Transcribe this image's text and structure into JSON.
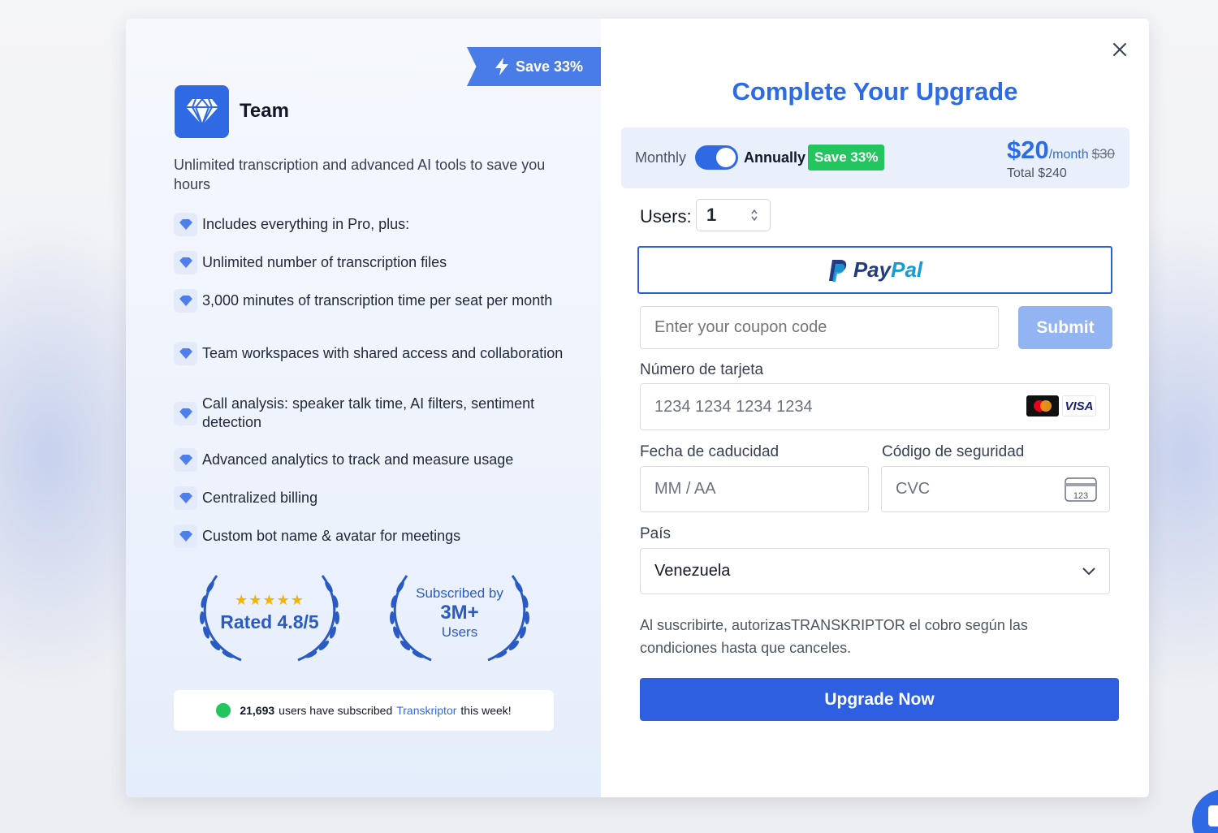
{
  "colors": {
    "accent": "#2d6be4",
    "success": "#22c55e",
    "submit_disabled": "#93b4f2"
  },
  "plan": {
    "ribbon_label": "Save 33%",
    "name": "Team",
    "description": "Unlimited transcription and advanced AI tools to save you hours",
    "icon": "diamond-icon",
    "features": [
      "Includes everything in Pro, plus:",
      "Unlimited number of transcription files",
      "3,000 minutes of transcription time per seat per month",
      "Team workspaces with shared access and collaboration",
      "Call analysis: speaker talk time, AI filters, sentiment detection",
      "Advanced analytics to track and measure usage",
      "Centralized billing",
      "Custom bot name & avatar for meetings"
    ],
    "rating": {
      "stars": "★★★★★",
      "label": "Rated 4.8/5"
    },
    "subscribers": {
      "top": "Subscribed by",
      "count": "3M+",
      "bottom": "Users"
    },
    "social_proof": {
      "count": "21,693",
      "text_before": "users have subscribed",
      "brand": "Transkriptor",
      "text_after": "this week!"
    }
  },
  "checkout": {
    "title": "Complete Your Upgrade",
    "billing": {
      "monthly_label": "Monthly",
      "annually_label": "Annually",
      "annual_selected": true,
      "save_badge": "Save 33%",
      "price": "$20",
      "per": "/month",
      "old_price": "$30",
      "total": "Total $240"
    },
    "users_label": "Users:",
    "users_value": "1",
    "paypal_label": "PayPal",
    "coupon_placeholder": "Enter your coupon code",
    "submit_label": "Submit",
    "card_number_label": "Número de tarjeta",
    "card_number_placeholder": "1234 1234 1234 1234",
    "card_brand_visa": "VISA",
    "expiry_label": "Fecha de caducidad",
    "expiry_placeholder": "MM / AA",
    "cvc_label": "Código de seguridad",
    "cvc_placeholder": "CVC",
    "cvc_icon_text": "123",
    "country_label": "País",
    "country_value": "Venezuela",
    "notice": "Al suscribirte, autorizasTRANSKRIPTOR el cobro según las condiciones hasta que canceles.",
    "upgrade_label": "Upgrade Now"
  }
}
